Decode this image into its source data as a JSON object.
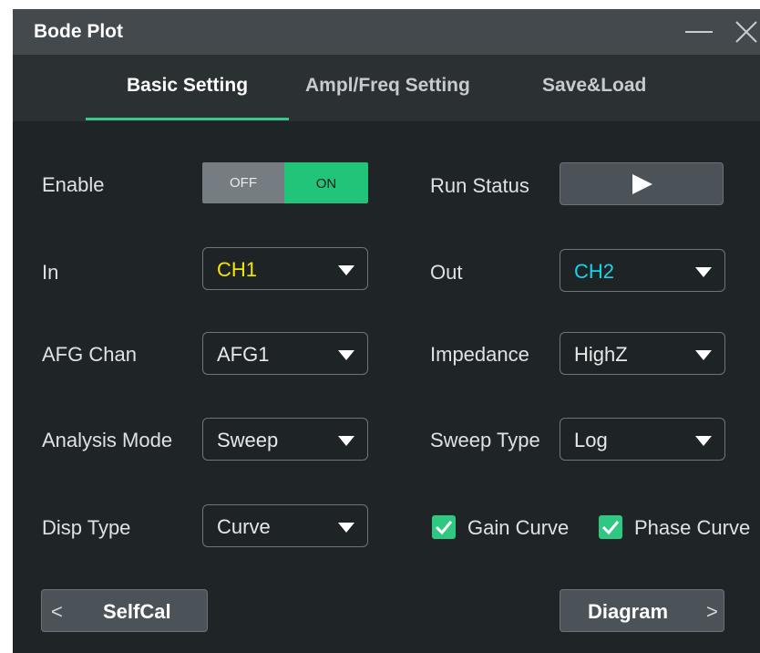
{
  "window": {
    "title": "Bode Plot"
  },
  "tabs": [
    {
      "label": "Basic Setting",
      "active": true
    },
    {
      "label": "Ampl/Freq Setting",
      "active": false
    },
    {
      "label": "Save&Load",
      "active": false
    }
  ],
  "fields": {
    "enable": {
      "label": "Enable",
      "off_label": "OFF",
      "on_label": "ON",
      "state": "ON"
    },
    "run_status": {
      "label": "Run Status",
      "icon": "play-icon"
    },
    "in": {
      "label": "In",
      "value": "CH1",
      "color": "#f3e600"
    },
    "out": {
      "label": "Out",
      "value": "CH2",
      "color": "#17d4e6"
    },
    "afg_chan": {
      "label": "AFG Chan",
      "value": "AFG1"
    },
    "impedance": {
      "label": "Impedance",
      "value": "HighZ"
    },
    "analysis_mode": {
      "label": "Analysis Mode",
      "value": "Sweep"
    },
    "sweep_type": {
      "label": "Sweep Type",
      "value": "Log"
    },
    "disp_type": {
      "label": "Disp Type",
      "value": "Curve"
    },
    "gain_curve": {
      "label": "Gain Curve",
      "checked": true
    },
    "phase_curve": {
      "label": "Phase Curve",
      "checked": true
    }
  },
  "buttons": {
    "selfcal": {
      "label": "SelfCal",
      "chevron": "<"
    },
    "diagram": {
      "label": "Diagram",
      "chevron": ">"
    }
  },
  "colors": {
    "accent": "#22c47a",
    "ch1": "#f3e600",
    "ch2": "#17d4e6",
    "background": "#1f2427"
  }
}
